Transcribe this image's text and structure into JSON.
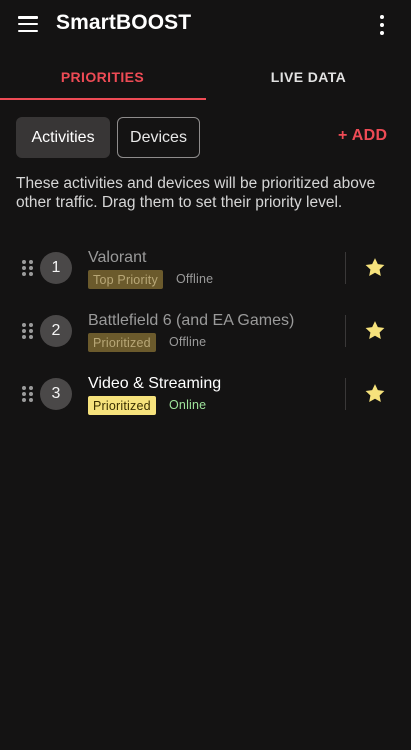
{
  "app": {
    "title": "SmartBOOST"
  },
  "tabs": [
    {
      "label": "PRIORITIES",
      "active": true
    },
    {
      "label": "LIVE DATA",
      "active": false
    }
  ],
  "filters": {
    "activities_label": "Activities",
    "devices_label": "Devices",
    "add_label": "+ ADD",
    "selected": "Activities"
  },
  "description": "These activities and devices will be prioritized above other traffic. Drag them to set their priority level.",
  "items": [
    {
      "number": "1",
      "name": "Valorant",
      "badge": "Top Priority",
      "status": "Offline",
      "starred": true
    },
    {
      "number": "2",
      "name": "Battlefield 6 (and EA Games)",
      "badge": "Prioritized",
      "status": "Offline",
      "starred": true
    },
    {
      "number": "3",
      "name": "Video & Streaming",
      "badge": "Prioritized",
      "status": "Online",
      "starred": true
    }
  ],
  "colors": {
    "accent": "#ee4b55",
    "star": "#f6e27c",
    "online": "#9ee39b",
    "background": "#141313"
  },
  "icons": {
    "menu": "hamburger-menu-icon",
    "more": "more-vert-icon",
    "drag": "drag-handle-icon",
    "star": "star-icon"
  }
}
